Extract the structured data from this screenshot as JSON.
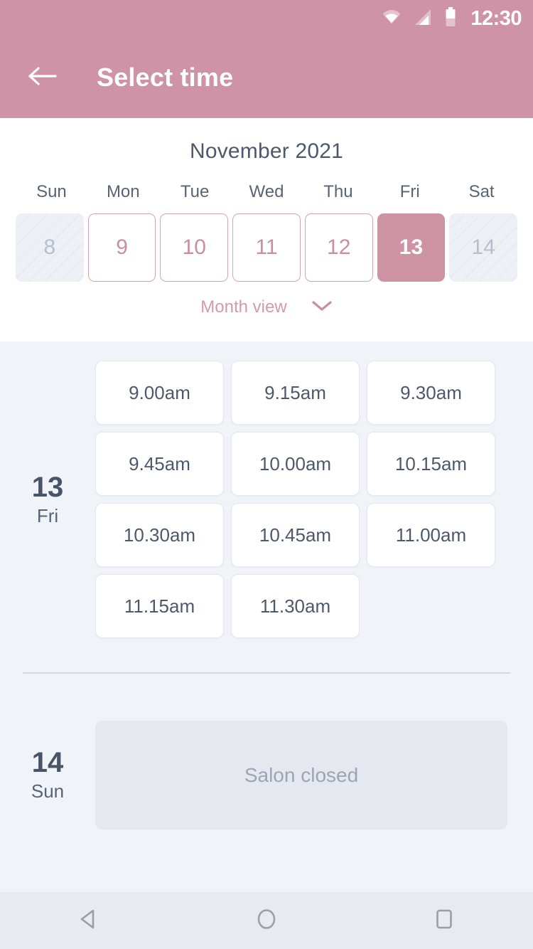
{
  "status_bar": {
    "time": "12:30",
    "icons": [
      "wifi-icon",
      "cellular-signal-icon",
      "battery-icon"
    ]
  },
  "app_bar": {
    "back_icon": "back-arrow-icon",
    "title": "Select time"
  },
  "calendar": {
    "month_label": "November 2021",
    "day_headers": [
      "Sun",
      "Mon",
      "Tue",
      "Wed",
      "Thu",
      "Fri",
      "Sat"
    ],
    "dates": [
      {
        "day": "8",
        "state": "disabled"
      },
      {
        "day": "9",
        "state": "available"
      },
      {
        "day": "10",
        "state": "available"
      },
      {
        "day": "11",
        "state": "available"
      },
      {
        "day": "12",
        "state": "available"
      },
      {
        "day": "13",
        "state": "selected"
      },
      {
        "day": "14",
        "state": "disabled"
      }
    ],
    "month_view_label": "Month view",
    "month_view_icon": "chevron-down-icon"
  },
  "schedule": {
    "days": [
      {
        "day_number": "13",
        "day_name": "Fri",
        "slots": [
          "9.00am",
          "9.15am",
          "9.30am",
          "9.45am",
          "10.00am",
          "10.15am",
          "10.30am",
          "10.45am",
          "11.00am",
          "11.15am",
          "11.30am"
        ]
      },
      {
        "day_number": "14",
        "day_name": "Sun",
        "closed_message": "Salon closed"
      }
    ]
  },
  "nav_bar": {
    "back": "nav-back-icon",
    "home": "nav-home-icon",
    "recents": "nav-recents-icon"
  },
  "colors": {
    "brand_pink": "#CE93A6",
    "selected_pink": "#CE93A3",
    "date_border_pink": "#D8A4B3",
    "date_text_pink": "#C98FA0",
    "slate_text": "#4E586C",
    "page_bg": "#F0F3F8",
    "closed_bg": "#E5E9EF"
  }
}
